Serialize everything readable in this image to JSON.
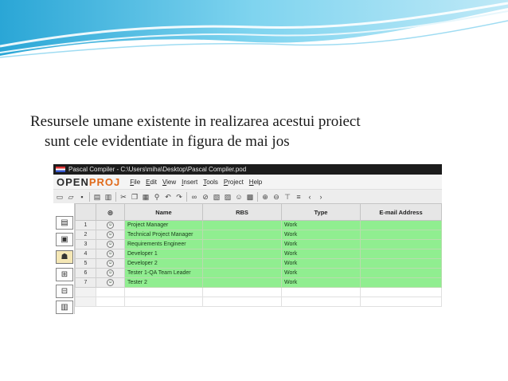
{
  "slide": {
    "text_line1": "Resursele umane existente in realizarea acestui proiect",
    "text_line2": "sunt cele evidentiate in figura de mai jos"
  },
  "window": {
    "title": "Pascal Compiler - C:\\Users\\miha\\Desktop\\Pascal Compiler.pod",
    "logo_a": "OPEN",
    "logo_b": "PROJ",
    "menu": [
      "File",
      "Edit",
      "View",
      "Insert",
      "Tools",
      "Project",
      "Help"
    ]
  },
  "table": {
    "columns": [
      "",
      "",
      "Name",
      "RBS",
      "Type",
      "E-mail Address"
    ],
    "rows": [
      {
        "num": "1",
        "name": "Project Manager",
        "rbs": "",
        "type": "Work",
        "email": ""
      },
      {
        "num": "2",
        "name": "Technical Project Manager",
        "rbs": "",
        "type": "Work",
        "email": ""
      },
      {
        "num": "3",
        "name": "Requirements Engineer",
        "rbs": "",
        "type": "Work",
        "email": ""
      },
      {
        "num": "4",
        "name": "Developer 1",
        "rbs": "",
        "type": "Work",
        "email": ""
      },
      {
        "num": "5",
        "name": "Developer 2",
        "rbs": "",
        "type": "Work",
        "email": ""
      },
      {
        "num": "6",
        "name": "Tester 1-QA Team Leader",
        "rbs": "",
        "type": "Work",
        "email": ""
      },
      {
        "num": "7",
        "name": "Tester 2",
        "rbs": "",
        "type": "Work",
        "email": ""
      }
    ]
  },
  "colors": {
    "row_highlight": "#90ee90",
    "wave_blue": "#3fb8e0",
    "logo_accent": "#e06a1a"
  }
}
